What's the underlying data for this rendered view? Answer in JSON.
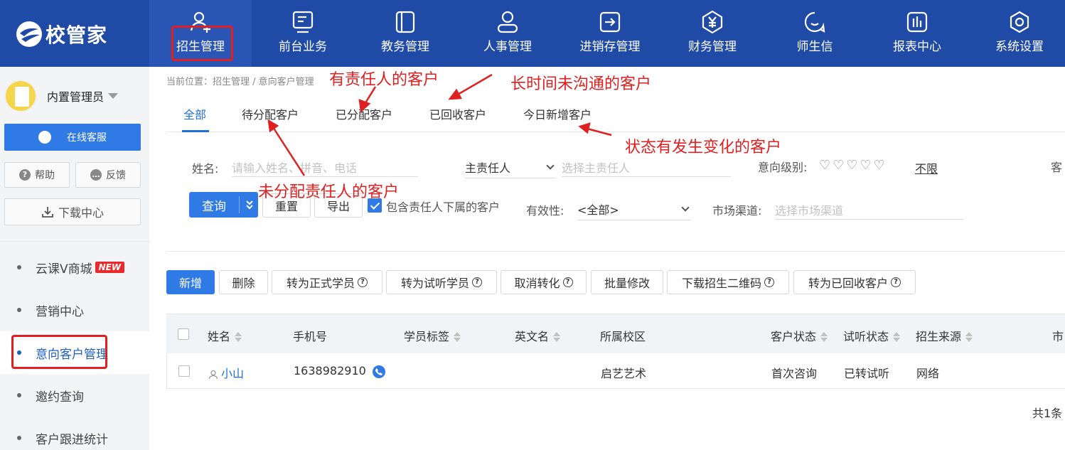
{
  "brand": {
    "name": "校管家"
  },
  "nav": [
    {
      "label": "招生管理",
      "icon": "user-add-icon",
      "active": true
    },
    {
      "label": "前台业务",
      "icon": "monitor-icon"
    },
    {
      "label": "教务管理",
      "icon": "book-icon"
    },
    {
      "label": "人事管理",
      "icon": "person-icon"
    },
    {
      "label": "进销存管理",
      "icon": "box-arrow-icon"
    },
    {
      "label": "财务管理",
      "icon": "yen-icon"
    },
    {
      "label": "师生信",
      "icon": "chat-icon"
    },
    {
      "label": "报表中心",
      "icon": "bar-chart-icon"
    },
    {
      "label": "系统设置",
      "icon": "settings-icon"
    }
  ],
  "sidebar": {
    "user_name": "内置管理员",
    "service_label": "在线客服",
    "help_label": "帮助",
    "feedback_label": "反馈",
    "download_label": "下载中心",
    "new_badge": "NEW",
    "items": [
      {
        "label": "云课V商城"
      },
      {
        "label": "营销中心"
      },
      {
        "label": "意向客户管理",
        "active": true
      },
      {
        "label": "邀约查询"
      },
      {
        "label": "客户跟进统计"
      }
    ]
  },
  "breadcrumb": "当前位置：招生管理 / 意向客户管理",
  "tabs": [
    "全部",
    "待分配客户",
    "已分配客户",
    "已回收客户",
    "今日新增客户"
  ],
  "filters": {
    "name_label": "姓名:",
    "name_placeholder": "请输入姓名、拼音、电话",
    "owner_select": "主责任人",
    "owner_placeholder": "选择主责任人",
    "level_label": "意向级别:",
    "hearts": "♡♡♡♡♡",
    "unlimited": "不限",
    "cut_label": "客",
    "validity_label": "有效性:",
    "validity_value": "<全部>",
    "channel_label": "市场渠道:",
    "channel_placeholder": "选择市场渠道",
    "query": "查询",
    "reset": "重置",
    "export": "导出",
    "include_sub": "包含责任人下属的客户"
  },
  "actions": [
    "新增",
    "删除",
    "转为正式学员",
    "转为试听学员",
    "取消转化",
    "批量修改",
    "下载招生二维码",
    "转为已回收客户"
  ],
  "table": {
    "headers": [
      "姓名",
      "手机号",
      "学员标签",
      "英文名",
      "所属校区",
      "客户状态",
      "试听状态",
      "招生来源",
      "市"
    ],
    "rows": [
      {
        "name": "小山",
        "phone": "1638982910",
        "tag": "",
        "english": "",
        "campus": "启艺艺术",
        "status": "首次咨询",
        "trial": "已转试听",
        "source": "网络"
      }
    ],
    "total": "共1条"
  },
  "annotations": {
    "responsible": "有责任人的客户",
    "long_time": "长时间未沟通的客户",
    "status_changed": "状态有发生变化的客户",
    "unassigned": "未分配责任人的客户"
  },
  "colors": {
    "topbar": "#1f4aa5",
    "primary": "#2f7ae5",
    "annotation": "#e02020"
  }
}
